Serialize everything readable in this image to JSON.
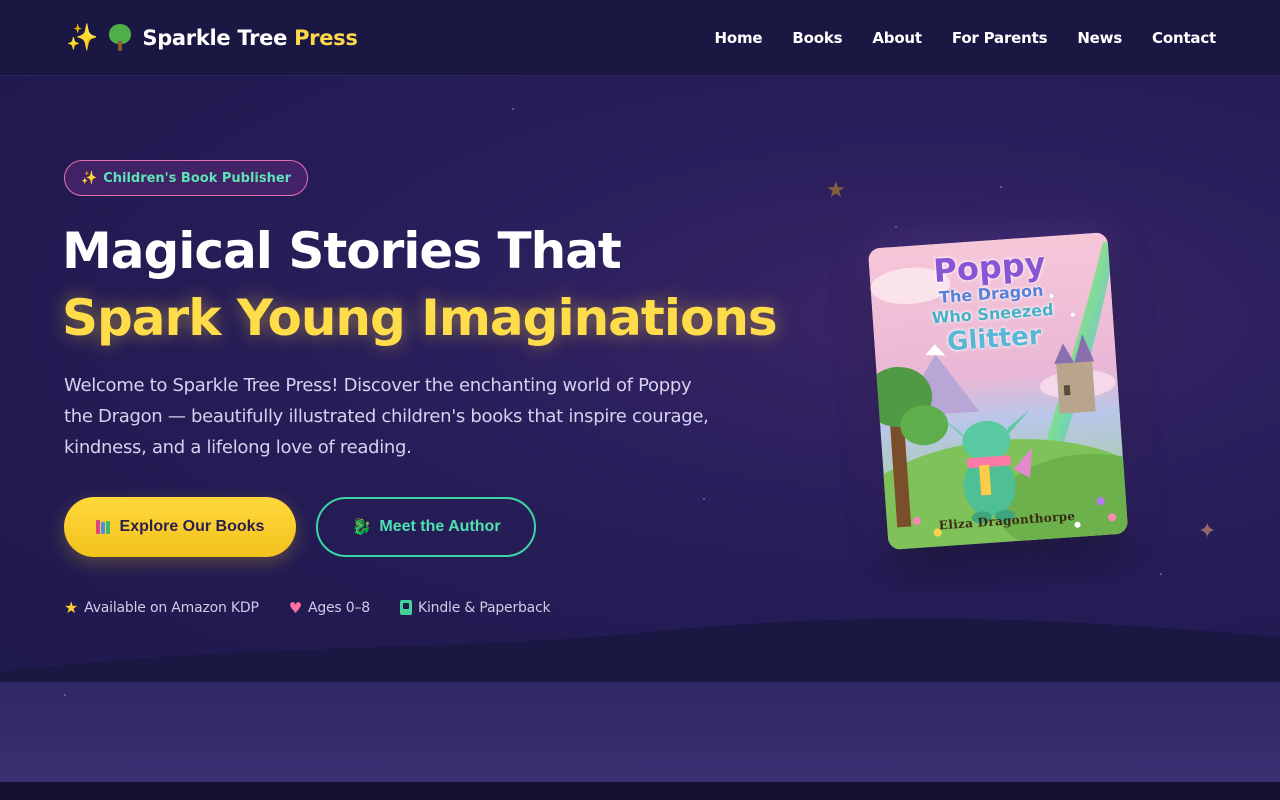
{
  "nav": {
    "brand_part1": "Sparkle Tree",
    "brand_part2": "Press",
    "links": [
      "Home",
      "Books",
      "About",
      "For Parents",
      "News",
      "Contact"
    ]
  },
  "hero": {
    "badge": "Children's Book Publisher",
    "headline_line1": "Magical Stories That",
    "headline_line2": "Spark Young Imaginations",
    "lead": "Welcome to Sparkle Tree Press! Discover the enchanting world of Poppy the Dragon — beautifully illustrated children's books that inspire courage, kindness, and a lifelong love of reading.",
    "primary_button": "Explore Our Books",
    "secondary_button": "Meet the Author",
    "features": [
      "Available on Amazon KDP",
      "Ages 0–8",
      "Kindle & Paperback"
    ]
  },
  "book": {
    "title_line1": "Poppy",
    "title_line2": "The Dragon",
    "title_line3": "Who Sneezed",
    "title_line4": "Glitter",
    "author": "Eliza Dragonthorpe"
  },
  "colors": {
    "accent_yellow": "#ffdc4a",
    "accent_teal": "#3dd4a4",
    "accent_pink": "#e86fb0",
    "background": "#221b52"
  },
  "icons": [
    "sparkle-icon",
    "tree-icon",
    "books-icon",
    "dragon-icon",
    "star-icon",
    "heart-icon",
    "kindle-icon"
  ]
}
